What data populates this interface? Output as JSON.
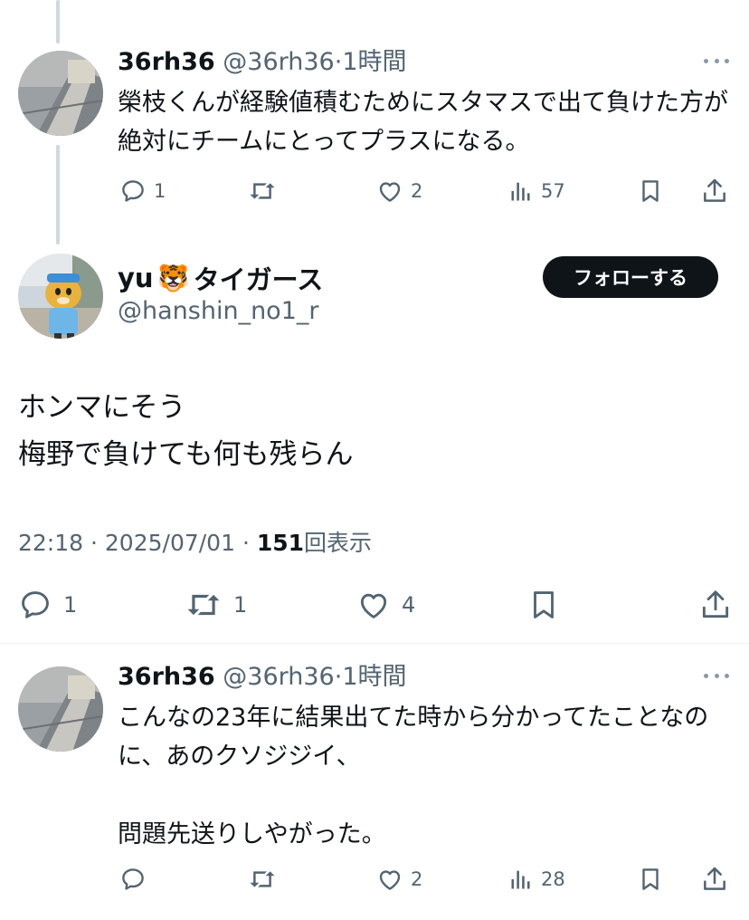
{
  "top_reply": {
    "name": "36rh36",
    "handle": "@36rh36",
    "separator": "·",
    "time": "1時間",
    "text": "榮枝くんが経験値積むためにスタマスで出て負けた方が絶対にチームにとってプラスになる。",
    "replies": "1",
    "reposts": "",
    "likes": "2",
    "views": "57"
  },
  "main_post": {
    "name": "yu",
    "name_emoji": "🐯",
    "name_suffix": "タイガース",
    "handle": "@hanshin_no1_r",
    "follow_label": "フォローする",
    "text": "ホンマにそう\n梅野で負けても何も残らん",
    "time": "22:18",
    "dot": "·",
    "date": "2025/07/01",
    "view_count": "151",
    "view_label": "回表示",
    "replies": "1",
    "reposts": "1",
    "likes": "4"
  },
  "bottom_reply": {
    "name": "36rh36",
    "handle": "@36rh36",
    "separator": "·",
    "time": "1時間",
    "text": "こんなの23年に結果出てた時から分かってたことなのに、あのクソジジイ、\n\n問題先送りしやがった。",
    "replies": "",
    "reposts": "",
    "likes": "2",
    "views": "28"
  },
  "colors": {
    "text": "#0f1419",
    "secondary": "#536471",
    "thread_line": "#cfd9de",
    "button_bg": "#0f1419"
  },
  "icons": [
    "reply-icon",
    "repost-icon",
    "like-icon",
    "views-icon",
    "bookmark-icon",
    "share-icon",
    "more-icon"
  ]
}
